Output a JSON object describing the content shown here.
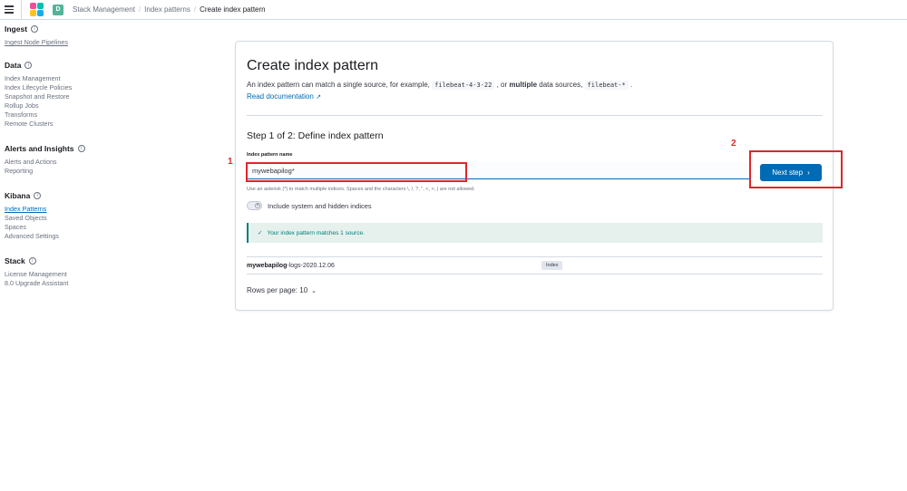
{
  "header": {
    "space_initial": "D",
    "breadcrumbs": [
      "Stack Management",
      "Index patterns",
      "Create index pattern"
    ]
  },
  "sidebar": {
    "groups": [
      {
        "title": "Ingest",
        "items": [
          "Ingest Node Pipelines"
        ]
      },
      {
        "title": "Data",
        "items": [
          "Index Management",
          "Index Lifecycle Policies",
          "Snapshot and Restore",
          "Rollup Jobs",
          "Transforms",
          "Remote Clusters"
        ]
      },
      {
        "title": "Alerts and Insights",
        "items": [
          "Alerts and Actions",
          "Reporting"
        ]
      },
      {
        "title": "Kibana",
        "items": [
          "Index Patterns",
          "Saved Objects",
          "Spaces",
          "Advanced Settings"
        ]
      },
      {
        "title": "Stack",
        "items": [
          "License Management",
          "8.0 Upgrade Assistant"
        ]
      }
    ]
  },
  "main": {
    "title": "Create index pattern",
    "desc_prefix": "An index pattern can match a single source, for example,",
    "example_single": "filebeat-4-3-22",
    "desc_middle": ", or",
    "desc_bold": "multiple",
    "desc_after": "data sources,",
    "example_multi": "filebeat-*",
    "desc_end": ".",
    "read_doc": "Read documentation",
    "step_title": "Step 1 of 2: Define index pattern",
    "field_label": "Index pattern name",
    "input_value": "mywebapilog*",
    "next_button": "Next step",
    "help_text": "Use an asterisk (*) to match multiple indices. Spaces and the characters \\, /, ?, \", <, >, | are not allowed.",
    "toggle_label": "Include system and hidden indices",
    "callout": "Your index pattern matches 1 source.",
    "result_name_bold": "mywebapilog",
    "result_name_rest": "-logs-2020.12.06",
    "result_badge": "Index",
    "rows_per_page": "Rows per page: 10"
  },
  "annotations": {
    "box1": "1",
    "box2": "2"
  },
  "colors": {
    "primary": "#006bb4",
    "success": "#017d73",
    "annotation": "#e0262c"
  }
}
